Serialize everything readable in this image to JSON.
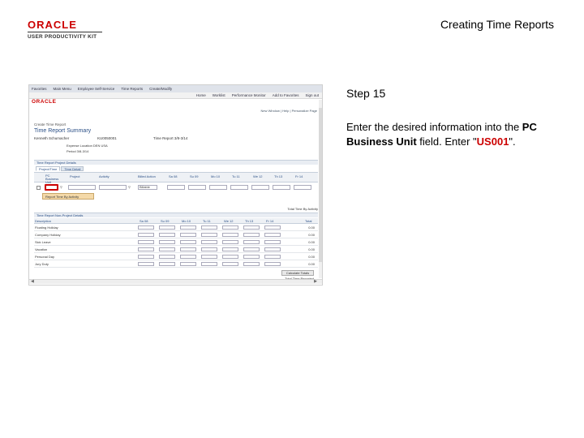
{
  "logo": {
    "word": "ORACLE",
    "sub": "USER PRODUCTIVITY KIT"
  },
  "slide_title": "Creating Time Reports",
  "step": {
    "label": "Step 15"
  },
  "instruction": {
    "prefix": "Enter the desired information into the ",
    "field_name": "PC Business Unit",
    "middle": " field. Enter \"",
    "value": "US001",
    "suffix": "\"."
  },
  "screenshot": {
    "menubar": [
      "Favorites",
      "Main Menu",
      "Employee Self-Service",
      "Time Reports",
      "Create/Modify"
    ],
    "navbar": [
      "Home",
      "Worklist",
      "Performance Monitor",
      "Add to Favorites",
      "Sign out"
    ],
    "ps_logo": "ORACLE",
    "util_links": "New Window | Help | Personalize Page",
    "crumb": "Create Time Report",
    "heading": "Time Report Summary",
    "employee": "Kenneth Schumacher",
    "employee_id": "KU0050001",
    "report_name": "Time Report 3/8-3/14",
    "info_row1": "Expense Location  DEN USA",
    "info_row2": "Period  3/8-3/14",
    "section1": "Time Report Project Details",
    "tabs": [
      "Project/Time",
      "Time Detail"
    ],
    "grid_headers": [
      "PC Business Unit",
      "Project",
      "Activity",
      "Billed Action",
      "Sa 08",
      "Su 09",
      "Mo 10",
      "Tu 11",
      "We 12",
      "Th 13",
      "Fr 14"
    ],
    "billed_action_value": "Billable",
    "add_button": "Report Time By Activity",
    "total_note": "Total Time By Activity",
    "section2": "Time Report Non-Project Details",
    "grid2_headers": [
      "Description",
      "Sa 08",
      "Su 09",
      "Mo 10",
      "Tu 11",
      "We 12",
      "Th 13",
      "Fr 14",
      "Total"
    ],
    "rows2": [
      {
        "label": "Floating Holiday",
        "total": "0.00"
      },
      {
        "label": "Company Holiday",
        "total": "0.00"
      },
      {
        "label": "Sick Leave",
        "total": "0.00"
      },
      {
        "label": "Vacation",
        "total": "0.00"
      },
      {
        "label": "Personal Day",
        "total": "0.00"
      },
      {
        "label": "Jury Duty",
        "total": "0.00"
      }
    ],
    "calc_button": "Calculate Totals",
    "grand_total": "Total Time Reported"
  }
}
